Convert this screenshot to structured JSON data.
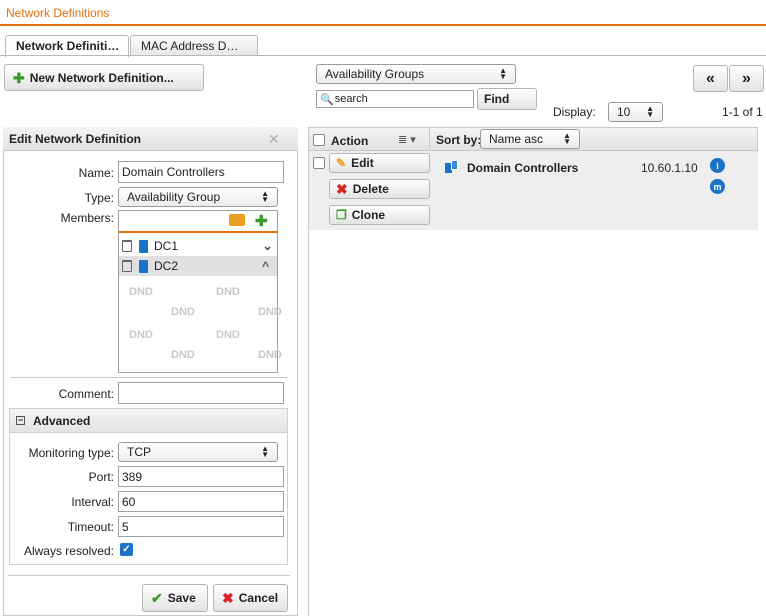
{
  "app": {
    "title": "Network Definitions"
  },
  "tabs": [
    {
      "label": "Network Definiti…"
    },
    {
      "label": "MAC Address D…"
    }
  ],
  "toolbar": {
    "new_button": "New Network Definition...",
    "filter_select": "Availability Groups",
    "search_placeholder": "search",
    "find_button": "Find",
    "display_label": "Display:",
    "display_value": "10",
    "paging": "1-1 of 1",
    "prev_label": "«",
    "next_label": "»"
  },
  "edit_panel": {
    "title": "Edit Network Definition",
    "name_label": "Name:",
    "name_value": "Domain Controllers",
    "type_label": "Type:",
    "type_value": "Availability Group",
    "members_label": "Members:",
    "members": [
      {
        "name": "DC1"
      },
      {
        "name": "DC2"
      }
    ],
    "dnd_text": "DND",
    "comment_label": "Comment:",
    "comment_value": "",
    "advanced": {
      "title": "Advanced",
      "monitoring_type_label": "Monitoring type:",
      "monitoring_type_value": "TCP",
      "port_label": "Port:",
      "port_value": "389",
      "interval_label": "Interval:",
      "interval_value": "60",
      "timeout_label": "Timeout:",
      "timeout_value": "5",
      "always_resolved_label": "Always resolved:",
      "always_resolved_checked": true
    },
    "save_button": "Save",
    "cancel_button": "Cancel"
  },
  "list": {
    "action_header": "Action",
    "sort_by_label": "Sort by:",
    "sort_value": "Name asc",
    "rows": [
      {
        "name": "Domain Controllers",
        "address": "10.60.1.10",
        "actions": {
          "edit": "Edit",
          "delete": "Delete",
          "clone": "Clone"
        },
        "info_badge": "i",
        "monitor_badge": "m"
      }
    ]
  },
  "colors": {
    "accent": "#e8700c",
    "info": "#1a73c8",
    "add": "#3a9a2a",
    "delete": "#dd2222"
  }
}
